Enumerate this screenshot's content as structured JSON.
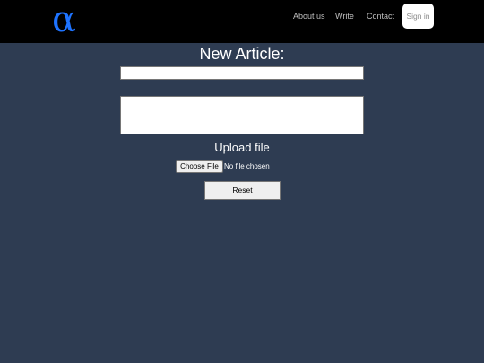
{
  "header": {
    "logo_glyph": "α",
    "logo_color": "#1e73ff",
    "background": "#000000",
    "nav": {
      "about": "About us",
      "write": "Write",
      "contact": "Contact"
    },
    "signin_label": "Sign in"
  },
  "form": {
    "title": "New Article:",
    "title_input_value": "",
    "body_input_value": "",
    "upload_label": "Upload file",
    "choose_file_label": "Choose File",
    "file_status": "No file chosen",
    "reset_label": "Reset"
  },
  "colors": {
    "page_background": "#2e3c52"
  }
}
